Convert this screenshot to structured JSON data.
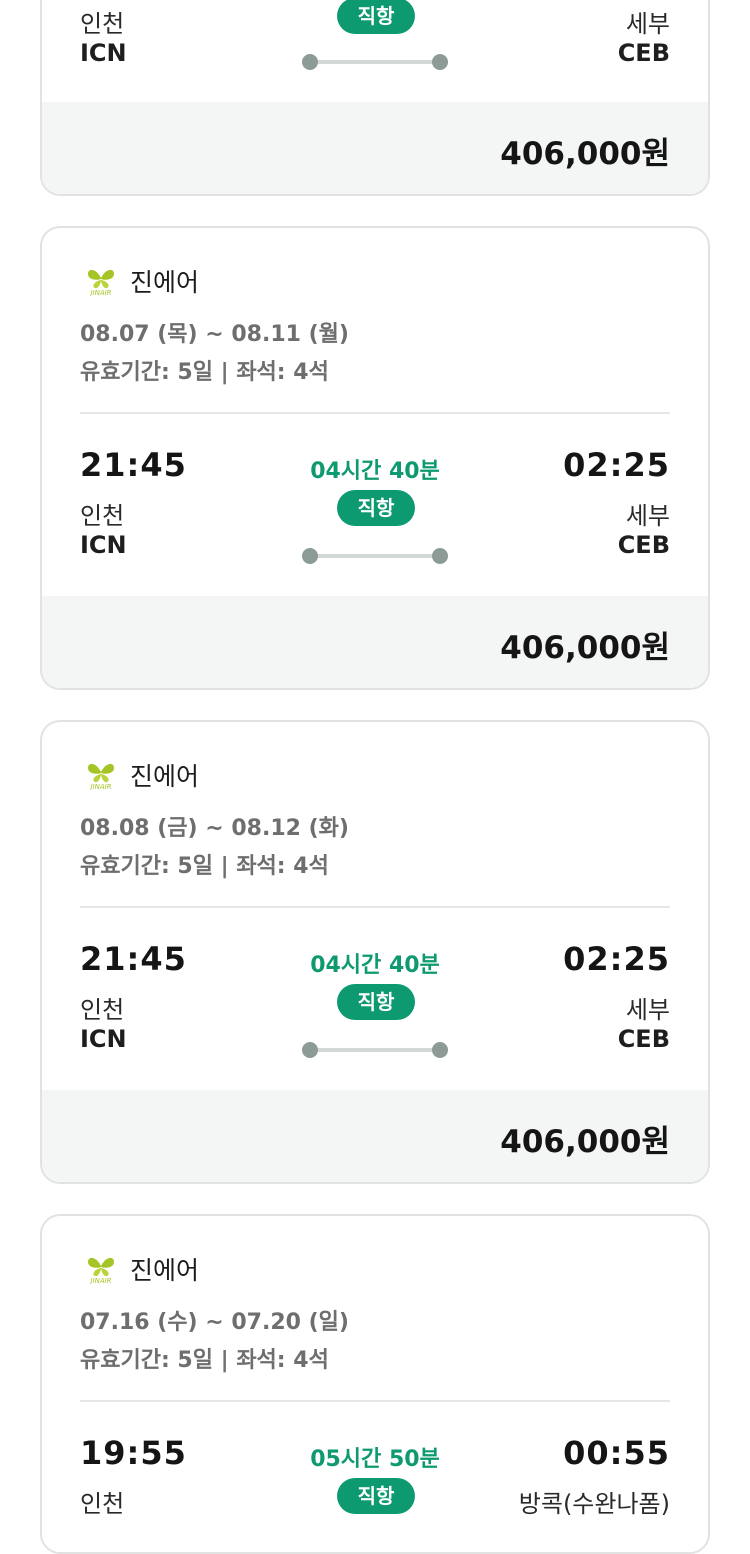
{
  "cards": [
    {
      "airline": "",
      "dates": "",
      "validity": "",
      "dep_time": "",
      "arr_time": "",
      "duration": "",
      "direct": "직항",
      "dep_city": "인천",
      "dep_code": "ICN",
      "arr_city": "세부",
      "arr_code": "CEB",
      "price": "406,000원"
    },
    {
      "airline": "진에어",
      "dates": "08.07 (목) ~ 08.11 (월)",
      "validity": "유효기간: 5일 | 좌석: 4석",
      "dep_time": "21:45",
      "arr_time": "02:25",
      "duration": "04시간 40분",
      "direct": "직항",
      "dep_city": "인천",
      "dep_code": "ICN",
      "arr_city": "세부",
      "arr_code": "CEB",
      "price": "406,000원"
    },
    {
      "airline": "진에어",
      "dates": "08.08 (금) ~ 08.12 (화)",
      "validity": "유효기간: 5일 | 좌석: 4석",
      "dep_time": "21:45",
      "arr_time": "02:25",
      "duration": "04시간 40분",
      "direct": "직항",
      "dep_city": "인천",
      "dep_code": "ICN",
      "arr_city": "세부",
      "arr_code": "CEB",
      "price": "406,000원"
    },
    {
      "airline": "진에어",
      "dates": "07.16 (수) ~ 07.20 (일)",
      "validity": "유효기간: 5일 | 좌석: 4석",
      "dep_time": "19:55",
      "arr_time": "00:55",
      "duration": "05시간 50분",
      "direct": "직항",
      "dep_city": "인천",
      "dep_code": "",
      "arr_city": "방콕(수완나폼)",
      "arr_code": "",
      "price": ""
    }
  ],
  "colors": {
    "accent_green": "#0e9a70",
    "logo_green": "#a5c526",
    "border": "#e1e3e3",
    "price_bg": "#f4f5f5"
  },
  "logo_icon": "jinair-butterfly-logo"
}
